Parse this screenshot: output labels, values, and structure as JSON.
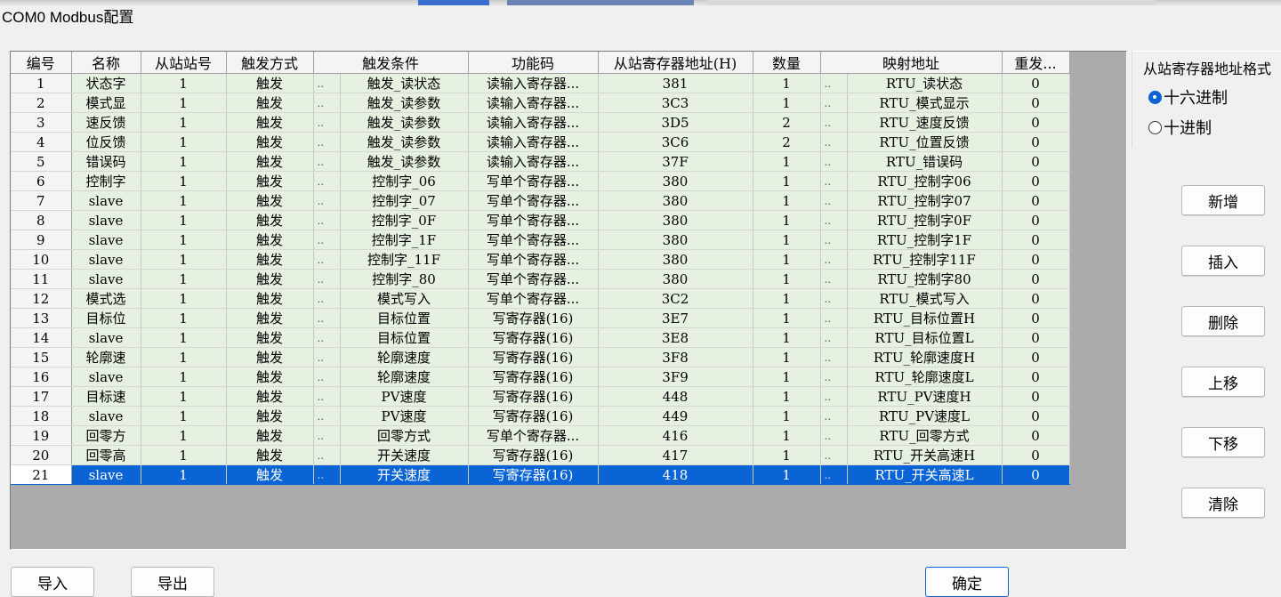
{
  "window": {
    "title": "COM0 Modbus配置"
  },
  "grid": {
    "headers": [
      "编号",
      "名称",
      "从站站号",
      "触发方式",
      "触发条件",
      "功能码",
      "从站寄存器地址(H)",
      "数量",
      "映射地址",
      "重发..."
    ],
    "rows": [
      {
        "no": "1",
        "name": "状态字",
        "station": "1",
        "trigger": "触发",
        "dots1": "..",
        "cond": "触发_读状态",
        "func": "读输入寄存器...",
        "addr": "381",
        "qty": "1",
        "dots2": "..",
        "map": "RTU_读状态",
        "resend": "0"
      },
      {
        "no": "2",
        "name": "模式显",
        "station": "1",
        "trigger": "触发",
        "dots1": "..",
        "cond": "触发_读参数",
        "func": "读输入寄存器...",
        "addr": "3C3",
        "qty": "1",
        "dots2": "..",
        "map": "RTU_模式显示",
        "resend": "0"
      },
      {
        "no": "3",
        "name": "速反馈",
        "station": "1",
        "trigger": "触发",
        "dots1": "..",
        "cond": "触发_读参数",
        "func": "读输入寄存器...",
        "addr": "3D5",
        "qty": "2",
        "dots2": "..",
        "map": "RTU_速度反馈",
        "resend": "0"
      },
      {
        "no": "4",
        "name": "位反馈",
        "station": "1",
        "trigger": "触发",
        "dots1": "..",
        "cond": "触发_读参数",
        "func": "读输入寄存器...",
        "addr": "3C6",
        "qty": "2",
        "dots2": "..",
        "map": "RTU_位置反馈",
        "resend": "0"
      },
      {
        "no": "5",
        "name": "错误码",
        "station": "1",
        "trigger": "触发",
        "dots1": "..",
        "cond": "触发_读参数",
        "func": "读输入寄存器...",
        "addr": "37F",
        "qty": "1",
        "dots2": "..",
        "map": "RTU_错误码",
        "resend": "0"
      },
      {
        "no": "6",
        "name": "控制字",
        "station": "1",
        "trigger": "触发",
        "dots1": "..",
        "cond": "控制字_06",
        "func": "写单个寄存器...",
        "addr": "380",
        "qty": "1",
        "dots2": "..",
        "map": "RTU_控制字06",
        "resend": "0"
      },
      {
        "no": "7",
        "name": "slave",
        "station": "1",
        "trigger": "触发",
        "dots1": "..",
        "cond": "控制字_07",
        "func": "写单个寄存器...",
        "addr": "380",
        "qty": "1",
        "dots2": "..",
        "map": "RTU_控制字07",
        "resend": "0"
      },
      {
        "no": "8",
        "name": "slave",
        "station": "1",
        "trigger": "触发",
        "dots1": "..",
        "cond": "控制字_0F",
        "func": "写单个寄存器...",
        "addr": "380",
        "qty": "1",
        "dots2": "..",
        "map": "RTU_控制字0F",
        "resend": "0"
      },
      {
        "no": "9",
        "name": "slave",
        "station": "1",
        "trigger": "触发",
        "dots1": "..",
        "cond": "控制字_1F",
        "func": "写单个寄存器...",
        "addr": "380",
        "qty": "1",
        "dots2": "..",
        "map": "RTU_控制字1F",
        "resend": "0"
      },
      {
        "no": "10",
        "name": "slave",
        "station": "1",
        "trigger": "触发",
        "dots1": "..",
        "cond": "控制字_11F",
        "func": "写单个寄存器...",
        "addr": "380",
        "qty": "1",
        "dots2": "..",
        "map": "RTU_控制字11F",
        "resend": "0"
      },
      {
        "no": "11",
        "name": "slave",
        "station": "1",
        "trigger": "触发",
        "dots1": "..",
        "cond": "控制字_80",
        "func": "写单个寄存器...",
        "addr": "380",
        "qty": "1",
        "dots2": "..",
        "map": "RTU_控制字80",
        "resend": "0"
      },
      {
        "no": "12",
        "name": "模式选",
        "station": "1",
        "trigger": "触发",
        "dots1": "..",
        "cond": "模式写入",
        "func": "写单个寄存器...",
        "addr": "3C2",
        "qty": "1",
        "dots2": "..",
        "map": "RTU_模式写入",
        "resend": "0"
      },
      {
        "no": "13",
        "name": "目标位",
        "station": "1",
        "trigger": "触发",
        "dots1": "..",
        "cond": "目标位置",
        "func": "写寄存器(16)",
        "addr": "3E7",
        "qty": "1",
        "dots2": "..",
        "map": "RTU_目标位置H",
        "resend": "0"
      },
      {
        "no": "14",
        "name": "slave",
        "station": "1",
        "trigger": "触发",
        "dots1": "..",
        "cond": "目标位置",
        "func": "写寄存器(16)",
        "addr": "3E8",
        "qty": "1",
        "dots2": "..",
        "map": "RTU_目标位置L",
        "resend": "0"
      },
      {
        "no": "15",
        "name": "轮廓速",
        "station": "1",
        "trigger": "触发",
        "dots1": "..",
        "cond": "轮廓速度",
        "func": "写寄存器(16)",
        "addr": "3F8",
        "qty": "1",
        "dots2": "..",
        "map": "RTU_轮廓速度H",
        "resend": "0"
      },
      {
        "no": "16",
        "name": "slave",
        "station": "1",
        "trigger": "触发",
        "dots1": "..",
        "cond": "轮廓速度",
        "func": "写寄存器(16)",
        "addr": "3F9",
        "qty": "1",
        "dots2": "..",
        "map": "RTU_轮廓速度L",
        "resend": "0"
      },
      {
        "no": "17",
        "name": "目标速",
        "station": "1",
        "trigger": "触发",
        "dots1": "..",
        "cond": "PV速度",
        "func": "写寄存器(16)",
        "addr": "448",
        "qty": "1",
        "dots2": "..",
        "map": "RTU_PV速度H",
        "resend": "0"
      },
      {
        "no": "18",
        "name": "slave",
        "station": "1",
        "trigger": "触发",
        "dots1": "..",
        "cond": "PV速度",
        "func": "写寄存器(16)",
        "addr": "449",
        "qty": "1",
        "dots2": "..",
        "map": "RTU_PV速度L",
        "resend": "0"
      },
      {
        "no": "19",
        "name": "回零方",
        "station": "1",
        "trigger": "触发",
        "dots1": "..",
        "cond": "回零方式",
        "func": "写单个寄存器...",
        "addr": "416",
        "qty": "1",
        "dots2": "..",
        "map": "RTU_回零方式",
        "resend": "0"
      },
      {
        "no": "20",
        "name": "回零高",
        "station": "1",
        "trigger": "触发",
        "dots1": "..",
        "cond": "开关速度",
        "func": "写寄存器(16)",
        "addr": "417",
        "qty": "1",
        "dots2": "..",
        "map": "RTU_开关高速H",
        "resend": "0"
      },
      {
        "no": "21",
        "name": "slave",
        "station": "1",
        "trigger": "触发",
        "dots1": "..",
        "cond": "开关速度",
        "func": "写寄存器(16)",
        "addr": "418",
        "qty": "1",
        "dots2": "..",
        "map": "RTU_开关高速L",
        "resend": "0"
      }
    ],
    "selected_row": 21
  },
  "address_format": {
    "legend": "从站寄存器地址格式",
    "options": [
      "十六进制",
      "十进制"
    ],
    "selected": "十六进制"
  },
  "buttons": {
    "add": "新增",
    "insert": "插入",
    "delete": "删除",
    "move_up": "上移",
    "move_down": "下移",
    "clear": "清除",
    "import": "导入",
    "export": "导出",
    "ok": "确定"
  },
  "colors": {
    "row_bg": "#e6f1e1",
    "selection": "#0a64d6",
    "grid_bg": "#ababab"
  }
}
